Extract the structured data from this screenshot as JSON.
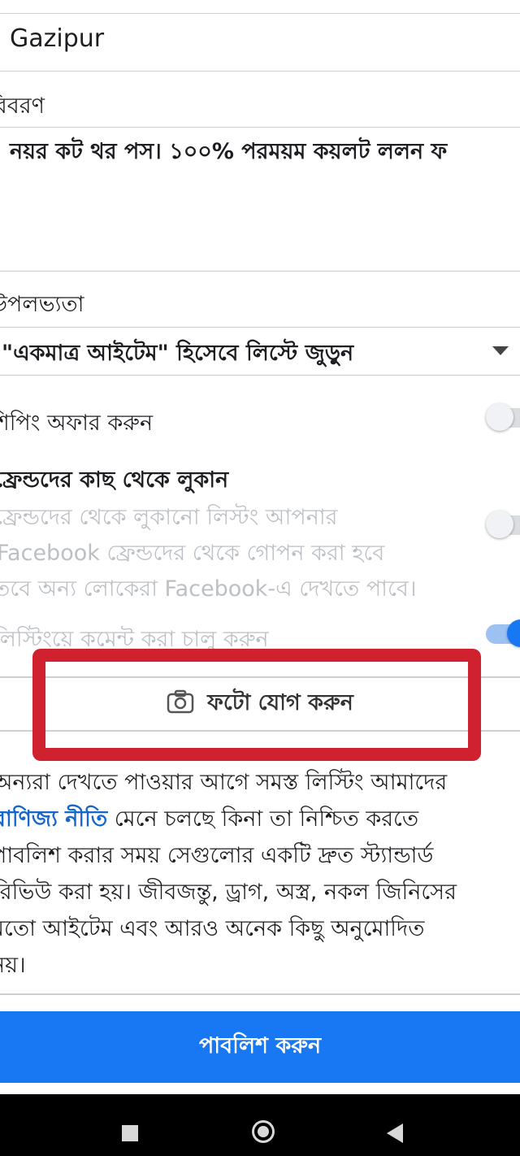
{
  "location": {
    "value": "Gazipur"
  },
  "description": {
    "label": "বিবরণ",
    "value": "নয়র কট থর পস। ১০০% পরময়ম কয়লট ললন ফ"
  },
  "availability": {
    "label": "উপলভ্যতা",
    "value": "\"একমাত্র আইটেম\" হিসেবে লিস্টে জুড়ুন"
  },
  "shipping": {
    "label": "শিপিং অফার করুন",
    "enabled": false
  },
  "hide_from_friends": {
    "label": "ফ্রেন্ডদের কাছ থেকে লুকান",
    "desc_line1": "ফ্রেন্ডদের থেকে লুকানো লিস্টং আপনার",
    "desc_line2": "Facebook ফ্রেন্ডদের থেকে গোপন করা হবে",
    "desc_line3": "তবে অন্য লোকেরা Facebook-এ দেখতে পাবে।",
    "enabled": false
  },
  "comments": {
    "label": "লিস্টিংয়ে কমেন্ট করা চালু করুন",
    "enabled": true
  },
  "add_photo": {
    "label": "ফটো যোগ করুন"
  },
  "policy": {
    "line1": "অন্যরা দেখতে পাওয়ার আগে সমস্ত লিস্টিং আমাদের",
    "link": "বাণিজ্য নীতি",
    "line2_rest": " মেনে চলছে কিনা তা নিশ্চিত করতে",
    "line3": "পাবলিশ করার সময় সেগুলোর একটি দ্রুত স্ট্যান্ডার্ড",
    "line4": "রিভিউ করা হয়। জীবজন্তু, ড্রাগ, অস্ত্র, নকল জিনিসের",
    "line5": "মতো আইটেম এবং আরও অনেক কিছু অনুমোদিত",
    "line6": "নয়।"
  },
  "publish": {
    "label": "পাবলিশ করুন"
  },
  "colors": {
    "accent": "#1877f2",
    "highlight": "#d0222e",
    "link": "#1766c9"
  },
  "icons": {
    "photo": "camera-icon",
    "dropdown": "caret-down-icon"
  }
}
